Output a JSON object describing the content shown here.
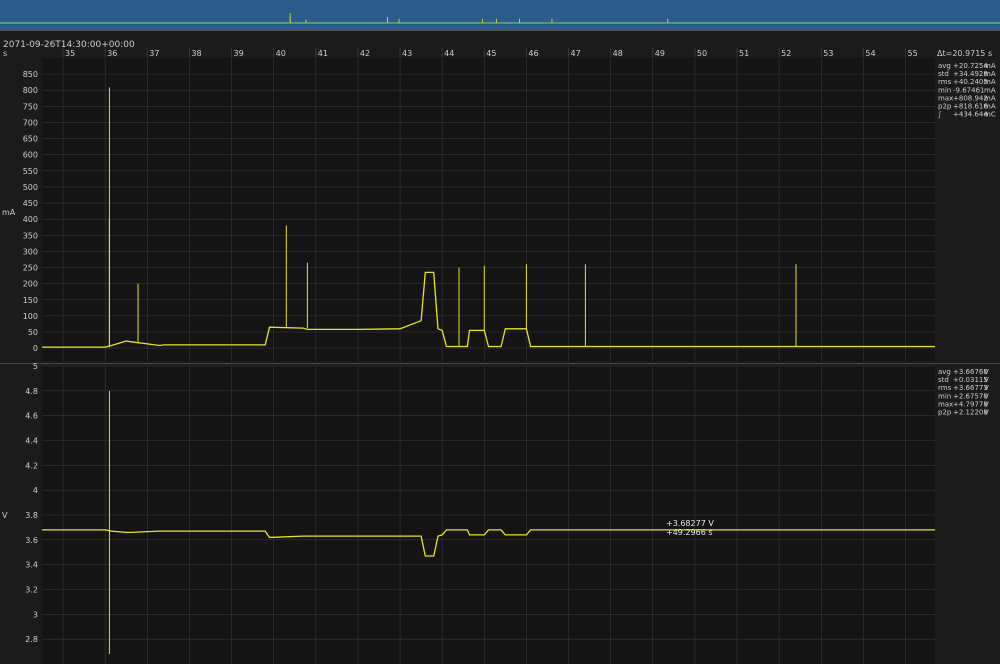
{
  "timestamp": "2071-09-26T14:30:00+00:00",
  "x_unit": "s",
  "delta_label": "Δt=20.9715 s",
  "colors": {
    "background": "#1b1b1b",
    "plot_bg": "#141414",
    "grid": "#383838",
    "axis_text": "#cfcfcf",
    "trace": "#e6e61e",
    "overview_bg": "#2b5c8a",
    "overview_trace": "#7fd08a"
  },
  "x_ticks": [
    "35",
    "36",
    "37",
    "38",
    "39",
    "40",
    "41",
    "42",
    "43",
    "44",
    "45",
    "46",
    "47",
    "48",
    "49",
    "50",
    "51",
    "52",
    "53",
    "54",
    "55"
  ],
  "current_stats": [
    {
      "label": "avg",
      "value": "+20.7254",
      "unit": "mA"
    },
    {
      "label": "std",
      "value": "+34.4928",
      "unit": "mA"
    },
    {
      "label": "rms",
      "value": "+40.2405",
      "unit": "mA"
    },
    {
      "label": "min",
      "value": "-9.67461",
      "unit": "mA"
    },
    {
      "label": "max",
      "value": "+808.942",
      "unit": "mA"
    },
    {
      "label": "p2p",
      "value": "+818.616",
      "unit": "mA"
    },
    {
      "label": "∫",
      "value": "+434.644",
      "unit": "mC"
    }
  ],
  "voltage_stats": [
    {
      "label": "avg",
      "value": "+3.66760",
      "unit": "V"
    },
    {
      "label": "std",
      "value": "+0.03115",
      "unit": "V"
    },
    {
      "label": "rms",
      "value": "+3.66773",
      "unit": "V"
    },
    {
      "label": "min",
      "value": "+2.67570",
      "unit": "V"
    },
    {
      "label": "max",
      "value": "+4.79778",
      "unit": "V"
    },
    {
      "label": "p2p",
      "value": "+2.12208",
      "unit": "V"
    }
  ],
  "cursor_readout": {
    "value": "+3.68277 V",
    "time": "+49.2966 s"
  },
  "chart_data": [
    {
      "type": "line",
      "ylabel": "mA",
      "x_unit": "s",
      "xlim": [
        34.5,
        55.7
      ],
      "ylim": [
        -40,
        900
      ],
      "yticks": [
        0,
        50,
        100,
        150,
        200,
        250,
        300,
        350,
        400,
        450,
        500,
        550,
        600,
        650,
        700,
        750,
        800,
        850
      ],
      "grid": true,
      "series": [
        {
          "x": [
            34.5,
            36.0,
            36.15,
            36.5,
            36.6,
            37.3,
            37.4,
            38.0,
            39.8,
            39.9,
            40.7,
            40.8,
            42.0,
            43.0,
            43.5,
            43.6,
            43.8,
            43.9,
            44.0,
            44.1,
            44.6,
            44.65,
            45.0,
            45.1,
            45.4,
            45.5,
            46.0,
            46.1,
            55.7
          ],
          "y": [
            3,
            3,
            8,
            22,
            20,
            8,
            10,
            10,
            10,
            65,
            62,
            58,
            58,
            60,
            85,
            235,
            235,
            60,
            55,
            5,
            5,
            55,
            55,
            5,
            5,
            60,
            60,
            5,
            5
          ]
        }
      ],
      "spikes": [
        {
          "x": 36.1,
          "y": 808.9
        },
        {
          "x": 36.1,
          "y": 400
        },
        {
          "x": 36.78,
          "y": 200
        },
        {
          "x": 40.3,
          "y": 380
        },
        {
          "x": 40.8,
          "y": 265
        },
        {
          "x": 44.4,
          "y": 250
        },
        {
          "x": 45.0,
          "y": 255
        },
        {
          "x": 46.0,
          "y": 260
        },
        {
          "x": 47.4,
          "y": 260
        },
        {
          "x": 52.4,
          "y": 260
        }
      ]
    },
    {
      "type": "line",
      "ylabel": "V",
      "x_unit": "s",
      "xlim": [
        34.5,
        55.7
      ],
      "ylim": [
        2.6,
        5.0
      ],
      "yticks": [
        2.8,
        3,
        3.2,
        3.4,
        3.6,
        3.8,
        4,
        4.2,
        4.4,
        4.6,
        4.8,
        5
      ],
      "grid": true,
      "series": [
        {
          "x": [
            34.5,
            36.0,
            36.15,
            36.5,
            36.6,
            37.3,
            37.4,
            39.8,
            39.9,
            40.7,
            40.8,
            43.5,
            43.6,
            43.8,
            43.9,
            44.0,
            44.1,
            44.6,
            44.65,
            45.0,
            45.1,
            45.4,
            45.5,
            46.0,
            46.1,
            55.7
          ],
          "y": [
            3.68,
            3.68,
            3.67,
            3.66,
            3.66,
            3.67,
            3.67,
            3.67,
            3.62,
            3.63,
            3.63,
            3.63,
            3.47,
            3.47,
            3.63,
            3.64,
            3.68,
            3.68,
            3.64,
            3.64,
            3.68,
            3.68,
            3.64,
            3.64,
            3.68,
            3.68
          ]
        }
      ],
      "spikes": [
        {
          "x": 36.1,
          "y": 4.8
        },
        {
          "x": 36.1,
          "y": 2.68
        }
      ]
    }
  ]
}
